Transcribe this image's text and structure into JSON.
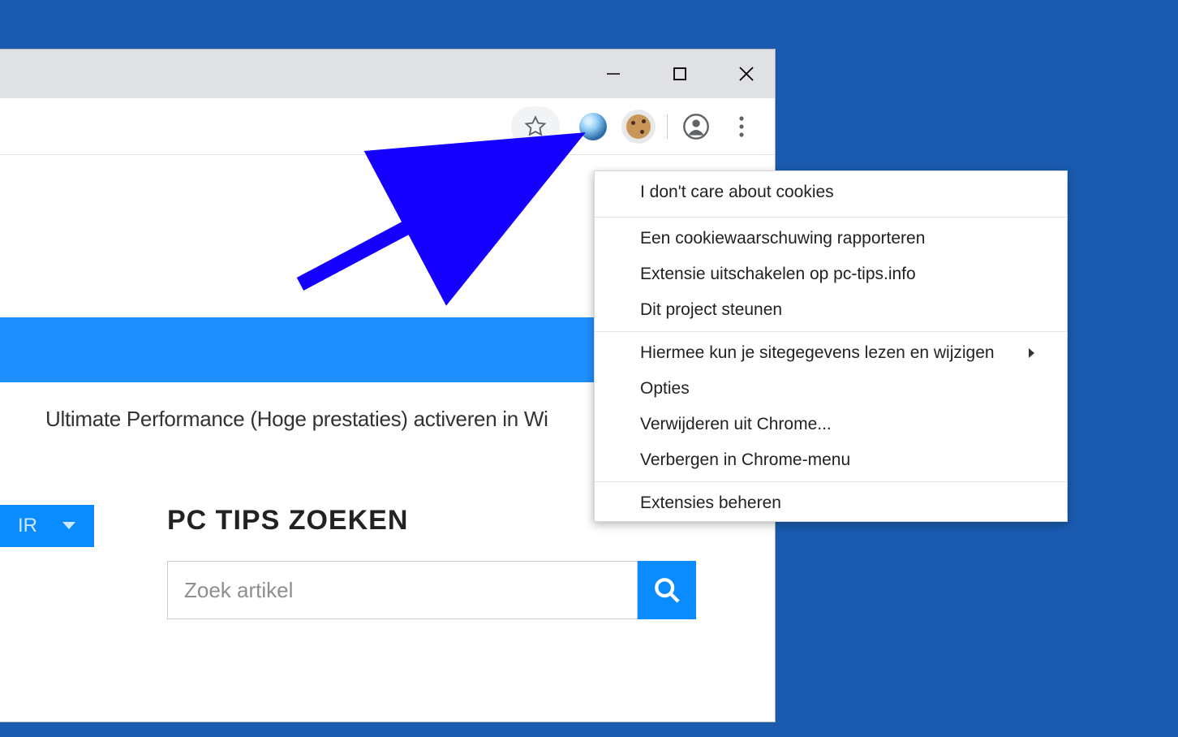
{
  "window": {
    "minimize_label": "minimize",
    "maximize_label": "maximize",
    "close_label": "close"
  },
  "toolbar": {
    "star_label": "bookmark",
    "globe_ext_label": "globe extension",
    "cookie_ext_label": "cookie extension",
    "account_label": "account",
    "menu_label": "chrome menu"
  },
  "page": {
    "article_title": "Ultimate Performance (Hoge prestaties) activeren in Wi",
    "search_heading": "PC TIPS ZOEKEN",
    "search_placeholder": "Zoek artikel",
    "repair_label": "IR"
  },
  "context_menu": {
    "title": "I don't care about cookies",
    "items": [
      "Een cookiewaarschuwing rapporteren",
      "Extensie uitschakelen op pc-tips.info",
      "Dit project steunen"
    ],
    "items2": [
      {
        "label": "Hiermee kun je sitegegevens lezen en wijzigen",
        "submenu": true
      },
      {
        "label": "Opties",
        "submenu": false
      },
      {
        "label": "Verwijderen uit Chrome...",
        "submenu": false
      },
      {
        "label": "Verbergen in Chrome-menu",
        "submenu": false
      }
    ],
    "items3": [
      "Extensies beheren"
    ]
  }
}
